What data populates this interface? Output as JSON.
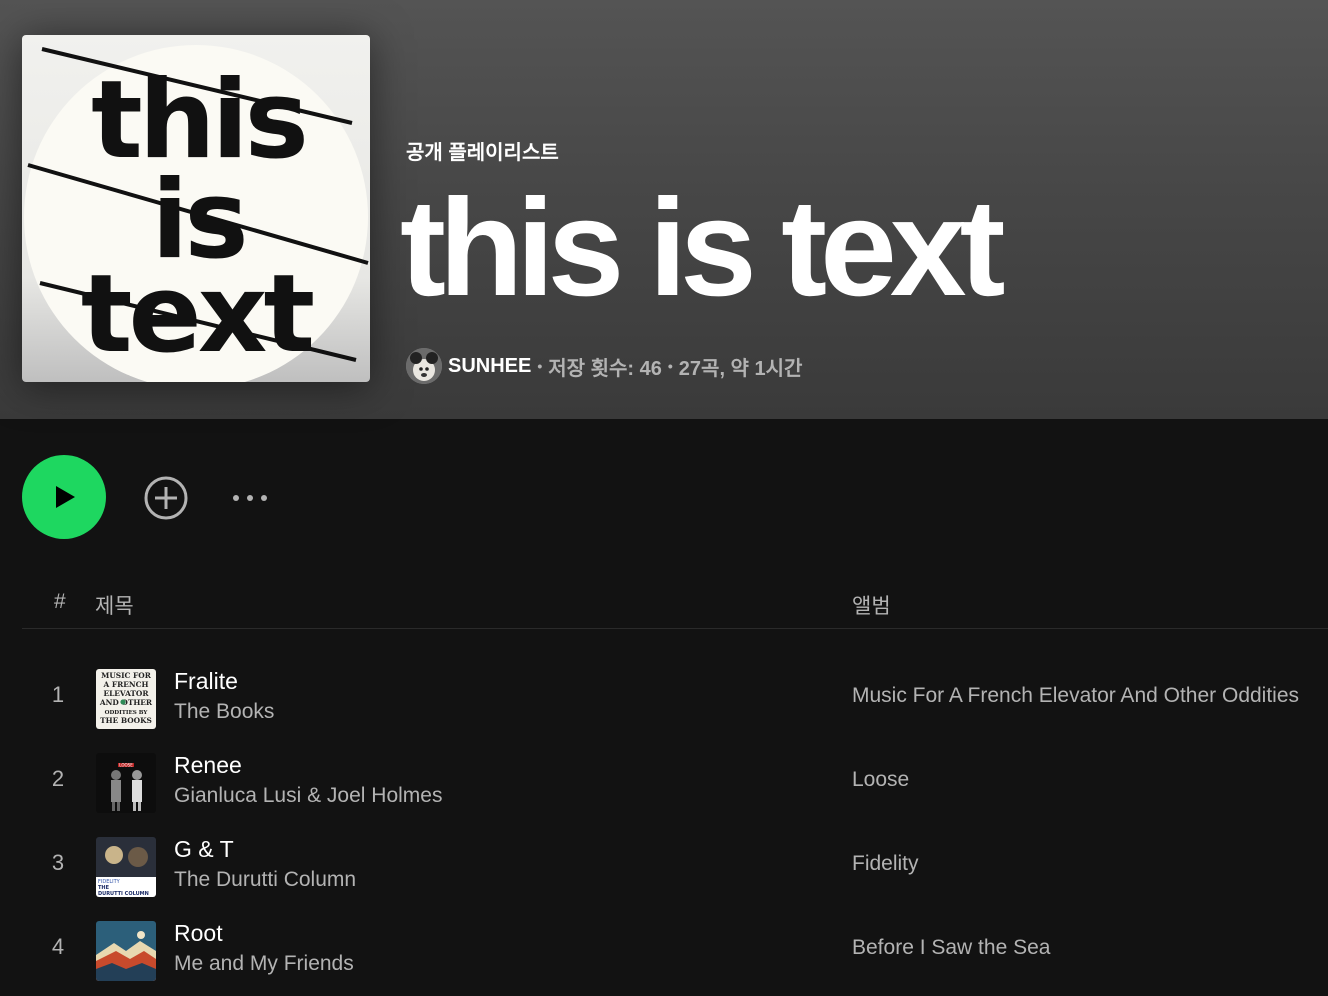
{
  "playlist": {
    "cover_text": [
      "this",
      "is",
      "text"
    ],
    "type_label": "공개 플레이리스트",
    "title": "this is text",
    "owner": "SUNHEE",
    "saves": "저장 횟수: 46",
    "summary": "27곡, 약 1시간",
    "separator": "•"
  },
  "actions": {
    "play_icon": "play-icon",
    "add_icon": "add-circle-icon",
    "more_icon": "more-options-icon",
    "play_color": "#1ed760"
  },
  "table": {
    "headers": {
      "number": "#",
      "title": "제목",
      "album": "앨범"
    },
    "tracks": [
      {
        "number": "1",
        "title": "Fralite",
        "artist": "The Books",
        "album": "Music For A French Elevator And Other Oddities",
        "cover_text": [
          "MUSIC FOR",
          "A FRENCH",
          "ELEVATOR",
          "AND OTHER",
          "ODDITIES BY",
          "THE BOOKS"
        ]
      },
      {
        "number": "2",
        "title": "Renee",
        "artist": "Gianluca Lusi & Joel Holmes",
        "album": "Loose",
        "cover_text": [
          "LOOSE"
        ]
      },
      {
        "number": "3",
        "title": "G & T",
        "artist": "The Durutti Column",
        "album": "Fidelity",
        "cover_text": [
          "FIDELITY",
          "THE",
          "DURUTTI COLUMN"
        ]
      },
      {
        "number": "4",
        "title": "Root",
        "artist": "Me and My Friends",
        "album": "Before I Saw the Sea"
      }
    ]
  }
}
